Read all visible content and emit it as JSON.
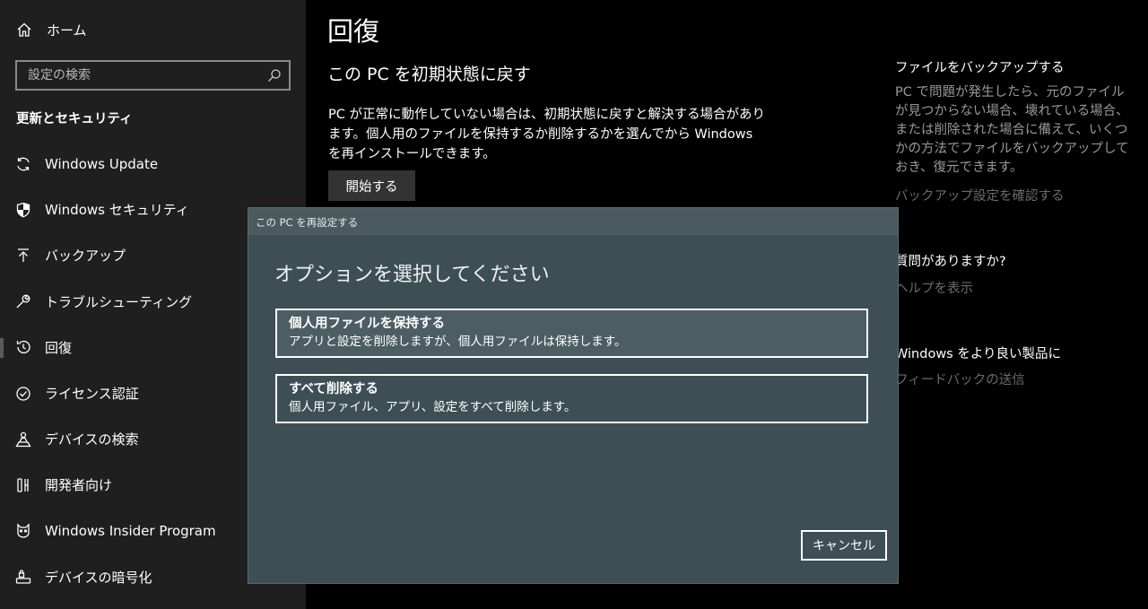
{
  "sidebar": {
    "home_label": "ホーム",
    "search_placeholder": "設定の検索",
    "section_title": "更新とセキュリティ",
    "items": [
      {
        "label": "Windows Update",
        "icon": "sync-icon"
      },
      {
        "label": "Windows セキュリティ",
        "icon": "shield-icon"
      },
      {
        "label": "バックアップ",
        "icon": "backup-arrow-icon"
      },
      {
        "label": "トラブルシューティング",
        "icon": "wrench-icon"
      },
      {
        "label": "回復",
        "icon": "history-icon"
      },
      {
        "label": "ライセンス認証",
        "icon": "check-circle-icon"
      },
      {
        "label": "デバイスの検索",
        "icon": "person-location-icon"
      },
      {
        "label": "開発者向け",
        "icon": "developer-tools-icon"
      },
      {
        "label": "Windows Insider Program",
        "icon": "insider-cat-icon"
      },
      {
        "label": "デバイスの暗号化",
        "icon": "drive-lock-icon"
      }
    ],
    "active_item": "回復"
  },
  "main": {
    "title": "回復",
    "subtitle": "この PC を初期状態に戻す",
    "description": "PC が正常に動作していない場合は、初期状態に戻すと解決する場合があります。個人用のファイルを保持するか削除するかを選んでから Windows を再インストールできます。",
    "start_button": "開始する"
  },
  "right_panel": {
    "backup_heading": "ファイルをバックアップする",
    "backup_text": "PC で問題が発生したら、元のファイルが見つからない場合、壊れている場合、または削除された場合に備えて、いくつかの方法でファイルをバックアップしておき、復元できます。",
    "backup_link": "バックアップ設定を確認する",
    "question_heading": "質問がありますか?",
    "help_link": "ヘルプを表示",
    "improve_heading": "Windows をより良い製品に",
    "feedback_link": "フィードバックの送信"
  },
  "dialog": {
    "window_title": "この PC を再設定する",
    "heading": "オプションを選択してください",
    "options": [
      {
        "title": "個人用ファイルを保持する",
        "description": "アプリと設定を削除しますが、個人用ファイルは保持します。"
      },
      {
        "title": "すべて削除する",
        "description": "個人用ファイル、アプリ、設定をすべて削除します。"
      }
    ],
    "cancel_button": "キャンセル"
  },
  "colors": {
    "sidebar_bg": "#1f1f1f",
    "main_bg": "#000000",
    "dialog_bg": "#3d4f55",
    "dialog_titlebar": "#4b5a5f",
    "link_gray": "#6b6b6b"
  }
}
